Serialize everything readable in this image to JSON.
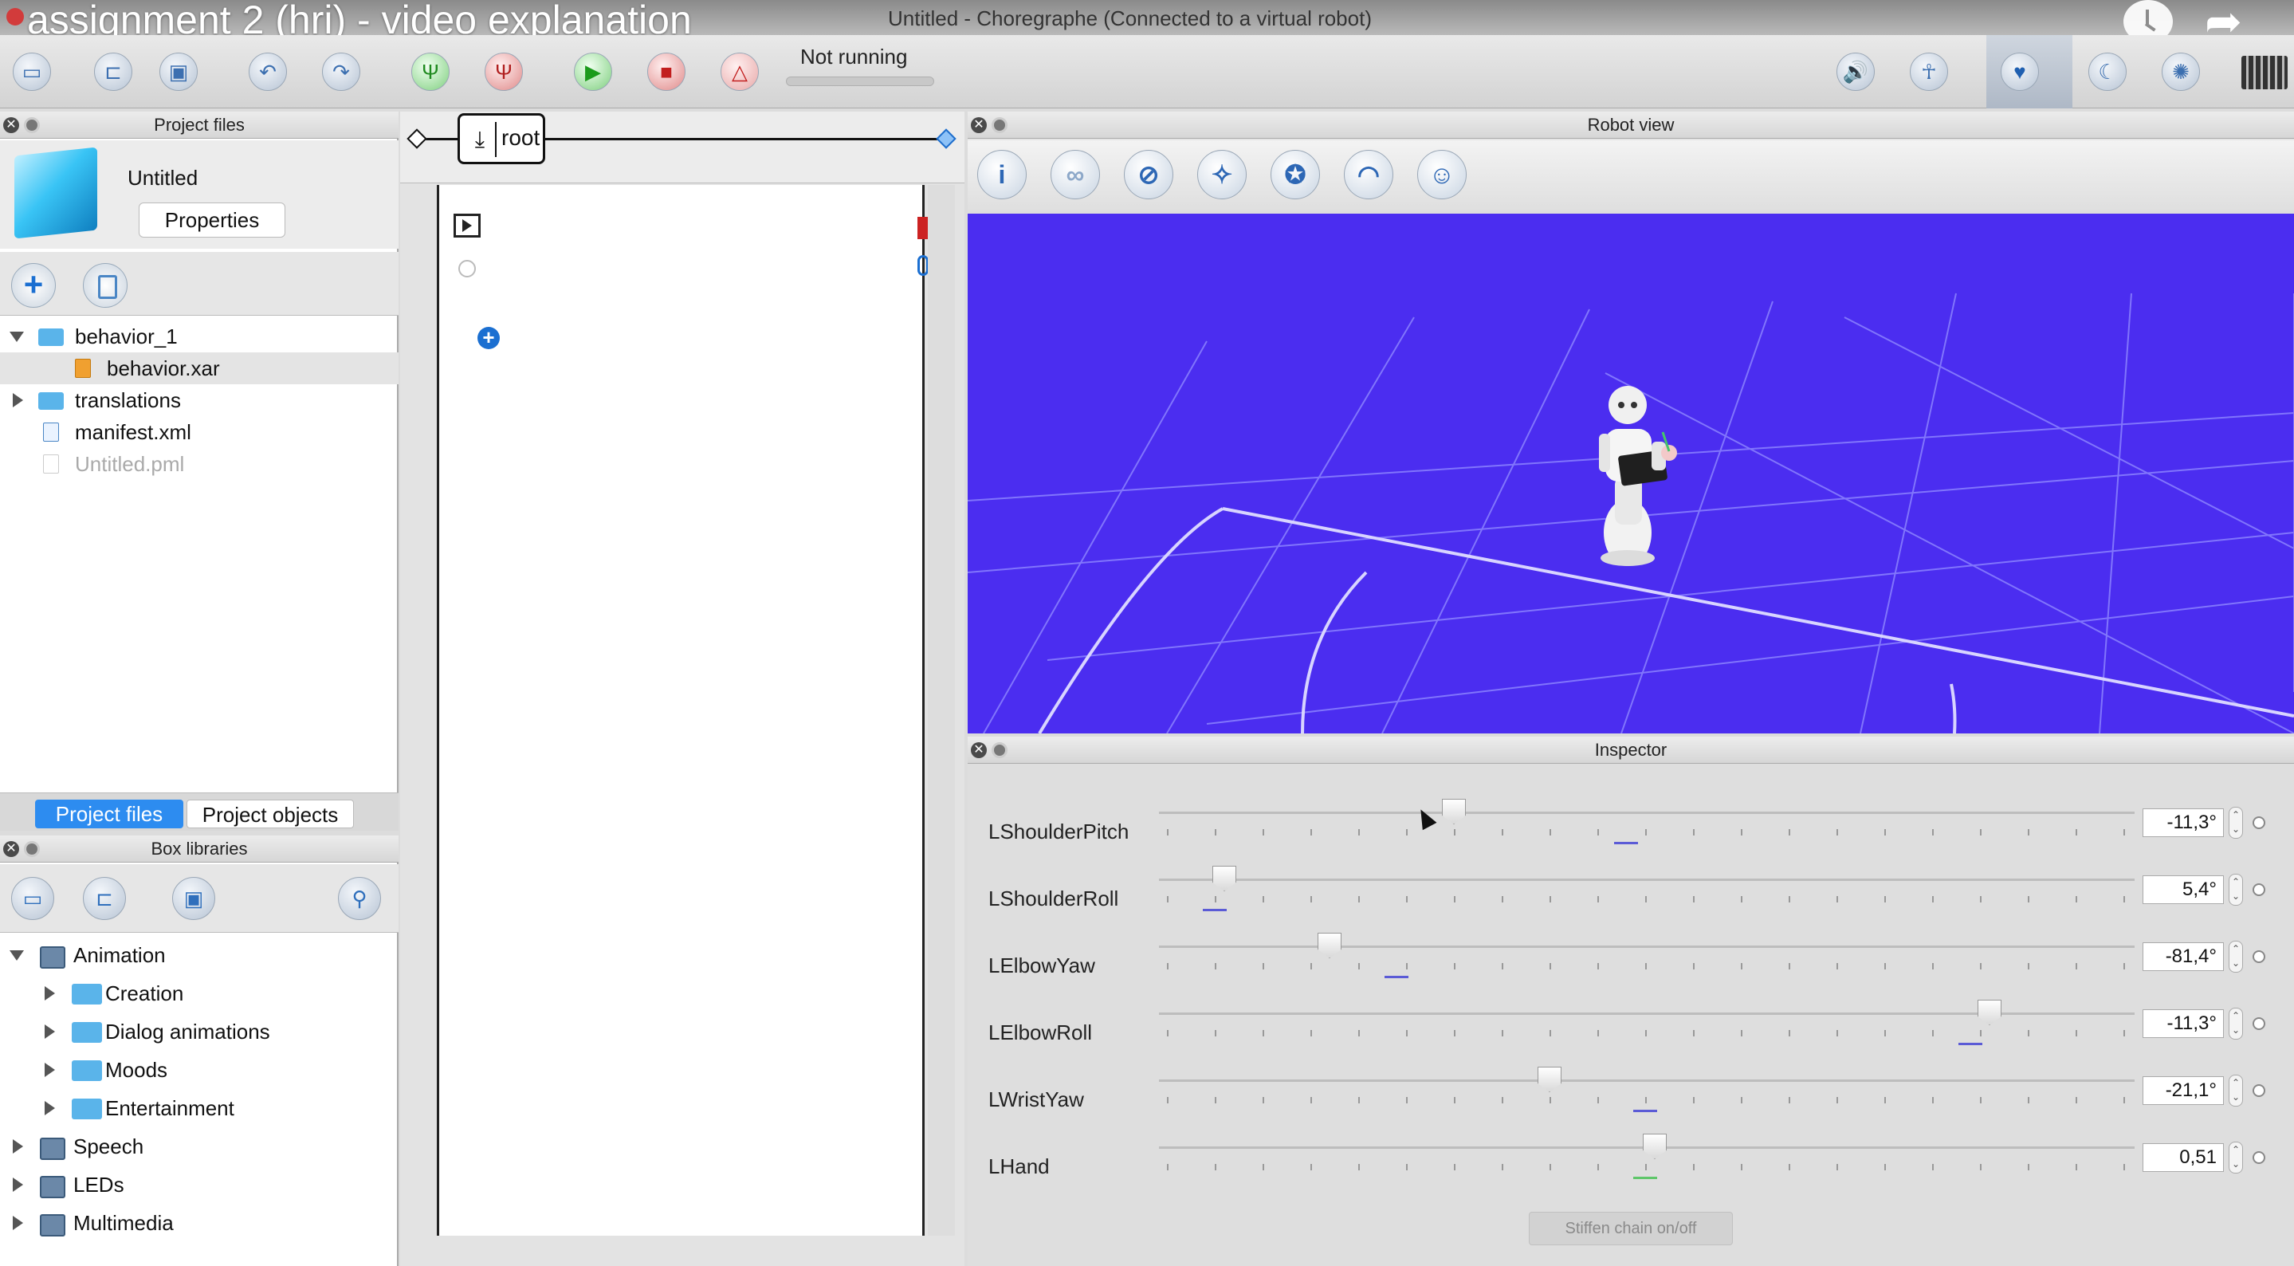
{
  "overlay": {
    "video_title": "assignment 2 (hri) - video explanation",
    "window_title": "Untitled - Choregraphe (Connected to a virtual robot)",
    "clock_icon": "clock-icon",
    "share_icon": "share-icon"
  },
  "toolbar": {
    "status": "Not running",
    "left_icons": [
      "new-project-icon",
      "open-project-icon",
      "save-project-icon",
      "undo-icon",
      "redo-icon",
      "connect-icon",
      "disconnect-icon",
      "play-icon",
      "stop-icon",
      "debug-icon"
    ],
    "right_icons": [
      "volume-icon",
      "animation-mode-icon",
      "life-icon",
      "rest-icon",
      "settings-icon",
      "battery-icon"
    ]
  },
  "project_files": {
    "header": "Project files",
    "project_name": "Untitled",
    "properties_label": "Properties",
    "tree": [
      {
        "label": "behavior_1",
        "type": "folder",
        "expanded": true,
        "depth": 0
      },
      {
        "label": "behavior.xar",
        "type": "xar",
        "depth": 1,
        "selected": true
      },
      {
        "label": "translations",
        "type": "folder",
        "expanded": false,
        "depth": 0
      },
      {
        "label": "manifest.xml",
        "type": "xml",
        "depth": 0
      },
      {
        "label": "Untitled.pml",
        "type": "pml",
        "depth": 0,
        "dimmed": true
      }
    ],
    "tabs": [
      "Project files",
      "Project objects"
    ],
    "active_tab": "Project files"
  },
  "box_libraries": {
    "header": "Box libraries",
    "tree": [
      {
        "label": "Animation",
        "type": "library",
        "expanded": true,
        "depth": 0
      },
      {
        "label": "Creation",
        "type": "folder",
        "depth": 1
      },
      {
        "label": "Dialog animations",
        "type": "folder",
        "depth": 1
      },
      {
        "label": "Moods",
        "type": "folder",
        "depth": 1
      },
      {
        "label": "Entertainment",
        "type": "folder",
        "depth": 1
      },
      {
        "label": "Speech",
        "type": "library",
        "depth": 0
      },
      {
        "label": "LEDs",
        "type": "library",
        "depth": 0
      },
      {
        "label": "Multimedia",
        "type": "library",
        "depth": 0
      }
    ]
  },
  "flow": {
    "root_label": "root"
  },
  "robot_view": {
    "header": "Robot view",
    "tool_icons": [
      "info-icon",
      "joints-icon",
      "motors-icon",
      "tactile-icon",
      "leds-icon",
      "sonar-icon",
      "face-icon"
    ],
    "background_color": "#4b2df0"
  },
  "inspector": {
    "header": "Inspector",
    "joints": [
      {
        "name": "LShoulderPitch",
        "value": "-11,3°",
        "position": 0.3,
        "target": 0.48
      },
      {
        "name": "LShoulderRoll",
        "value": "5,4°",
        "position": 0.06,
        "target": 0.05
      },
      {
        "name": "LElbowYaw",
        "value": "-81,4°",
        "position": 0.17,
        "target": 0.24
      },
      {
        "name": "LElbowRoll",
        "value": "-11,3°",
        "position": 0.86,
        "target": 0.84
      },
      {
        "name": "LWristYaw",
        "value": "-21,1°",
        "position": 0.4,
        "target": 0.5
      },
      {
        "name": "LHand",
        "value": "0,51",
        "position": 0.51,
        "target": 0.5
      }
    ],
    "stiffen_label": "Stiffen chain on/off"
  }
}
